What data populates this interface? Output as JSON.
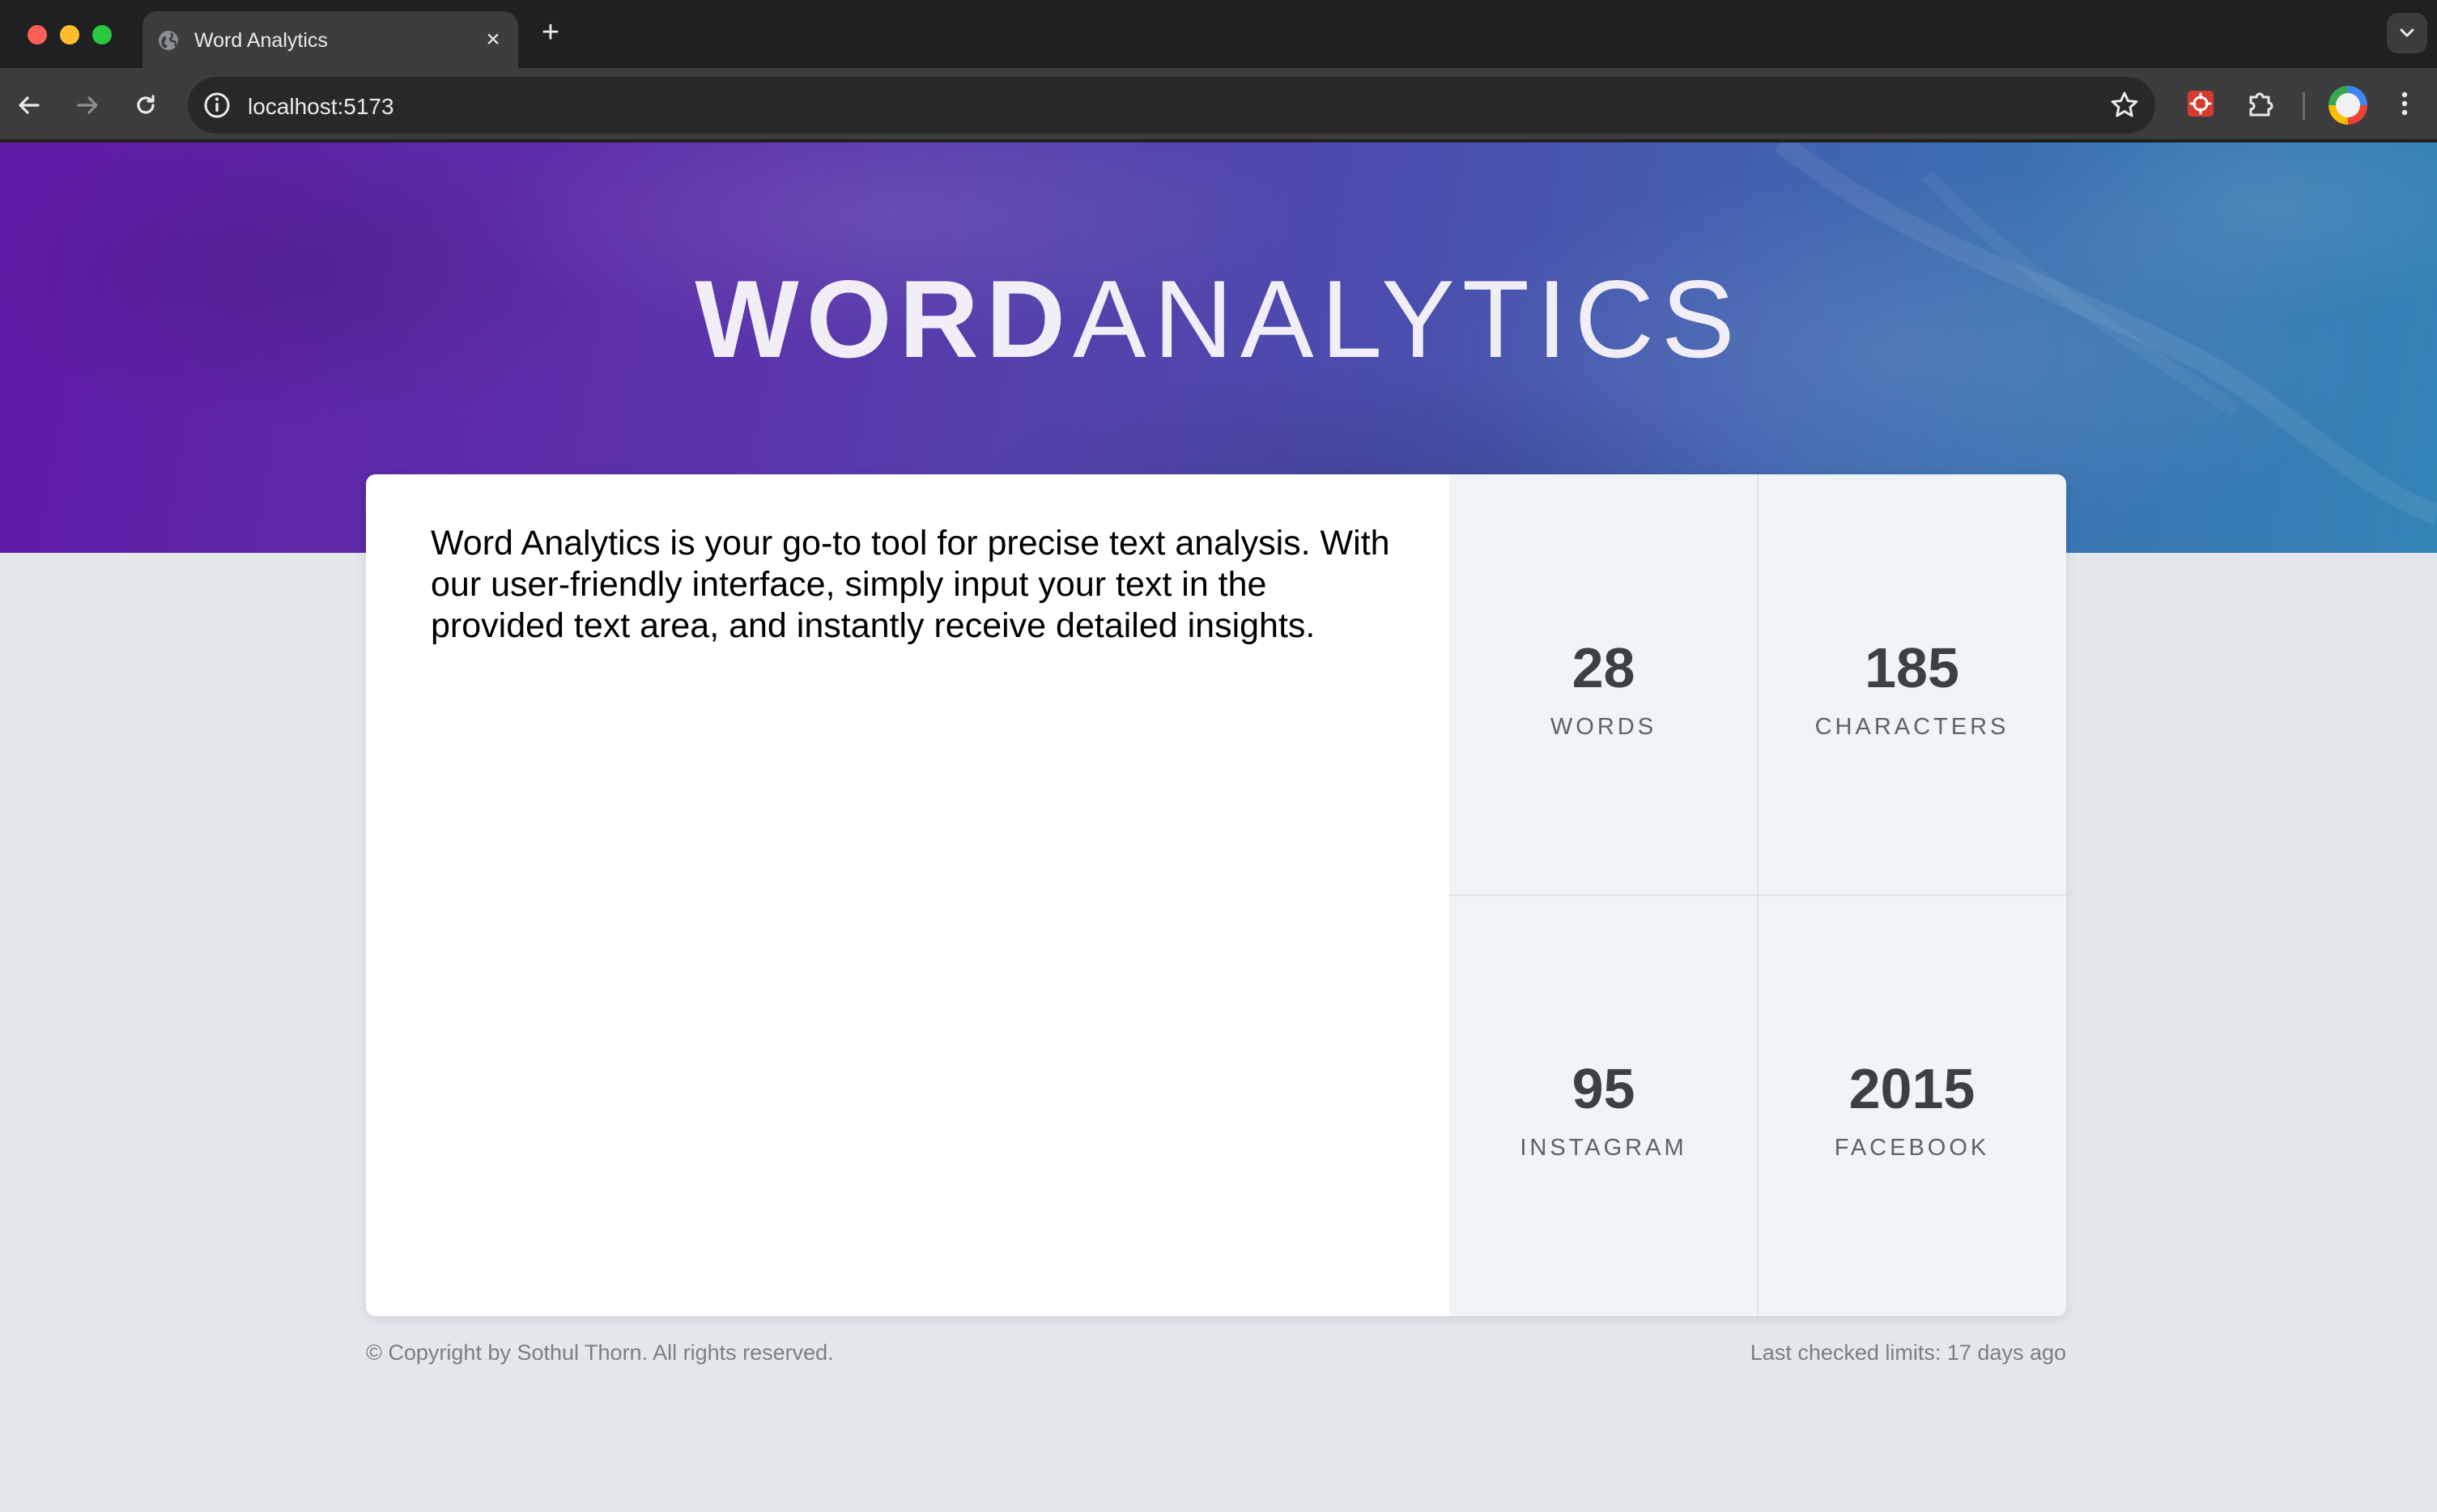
{
  "browser": {
    "tab_title": "Word Analytics",
    "url": "localhost:5173",
    "icons": {
      "back": "arrow-left-icon",
      "forward": "arrow-right-icon",
      "reload": "reload-icon",
      "info": "info-icon",
      "bookmark": "star-icon",
      "extension": "puzzle-icon",
      "menu": "kebab-menu-icon"
    }
  },
  "header": {
    "title_bold": "WORD",
    "title_light": "ANALYTICS"
  },
  "editor": {
    "text": "Word Analytics is your go-to tool for precise text analysis. With our user-friendly interface, simply input your text in the provided text area, and instantly receive detailed insights."
  },
  "stats": {
    "words": {
      "number": "28",
      "label": "WORDS"
    },
    "characters": {
      "number": "185",
      "label": "CHARACTERS"
    },
    "instagram": {
      "number": "95",
      "label": "INSTAGRAM"
    },
    "facebook": {
      "number": "2015",
      "label": "FACEBOOK"
    }
  },
  "footer": {
    "copyright": "© Copyright by Sothul Thorn. All rights reserved.",
    "last_checked": "Last checked limits: 17 days ago"
  },
  "colors": {
    "gradient_start": "#611ba6",
    "gradient_end": "#3484b6",
    "page_background": "#e4e8ec",
    "stats_background": "#f1f4f7",
    "stat_number": "#3c4046"
  }
}
